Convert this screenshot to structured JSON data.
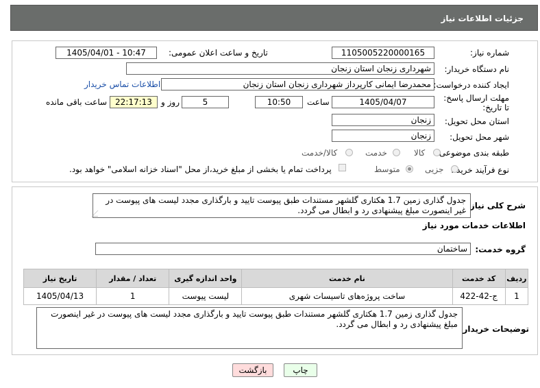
{
  "header": {
    "title": "جزئیات اطلاعات نیاز"
  },
  "form": {
    "need_number_label": "شماره نیاز:",
    "need_number": "1105005220000165",
    "announce_label": "تاریخ و ساعت اعلان عمومی:",
    "announce_value": "1405/04/01 - 10:47",
    "buyer_org_label": "نام دستگاه خریدار:",
    "buyer_org": "شهرداری زنجان استان زنجان",
    "creator_label": "ایجاد کننده درخواست:",
    "creator": "محمدرضا  ایمانی کارپرداز شهرداری زنجان استان زنجان",
    "contact_link": "اطلاعات تماس خریدار",
    "deadline_label": "مهلت ارسال پاسخ: تا تاریخ:",
    "deadline_date": "1405/04/07",
    "time_label": "ساعت",
    "deadline_time": "10:50",
    "days_value": "5",
    "days_label": "روز و",
    "remaining_time": "22:17:13",
    "remaining_label": "ساعت باقی مانده",
    "province_label": "استان محل تحویل:",
    "province": "زنجان",
    "city_label": "شهر محل تحویل:",
    "city": "زنجان",
    "category_label": "طبقه بندی موضوعی:",
    "category_options": [
      "کالا",
      "خدمت",
      "کالا/خدمت"
    ],
    "process_label": "نوع فرآیند خرید :",
    "process_options": [
      "جزیی",
      "متوسط"
    ],
    "payment_note": "پرداخت تمام یا بخشی از مبلغ خرید،از محل \"اسناد خزانه اسلامی\" خواهد بود."
  },
  "description": {
    "label": "شرح کلی نیاز:",
    "text": "جدول گذاری زمین 1.7 هکتاری گلشهر مستندات طبق پیوست تایید و بارگذاری مجدد لیست های پیوست در غیر اینصورت مبلغ پیشنهادی رد و ابطال می گردد."
  },
  "services": {
    "section_title": "اطلاعات خدمات مورد نیاز",
    "group_label": "گروه خدمت:",
    "group_value": "ساختمان",
    "columns": [
      "ردیف",
      "کد خدمت",
      "نام خدمت",
      "واحد اندازه گیری",
      "تعداد / مقدار",
      "تاریخ نیاز"
    ],
    "rows": [
      {
        "index": "1",
        "code": "ج-42-422",
        "name": "ساخت پروژه‌های تاسیسات شهری",
        "unit": "لیست پیوست",
        "qty": "1",
        "date": "1405/04/13"
      }
    ]
  },
  "buyer_notes": {
    "label": "توضیحات خریدار:",
    "text": "جدول گذاری زمین 1.7 هکتاری گلشهر مستندات طبق پیوست تایید و بارگذاری مجدد لیست های پیوست در غیر اینصورت مبلغ پیشنهادی رد و ابطال می گردد."
  },
  "buttons": {
    "print": "چاپ",
    "back": "بازگشت"
  },
  "colors": {
    "header_bg": "#6a6d6b",
    "back_button_bg": "#ffdcdc",
    "print_button_bg": "#e9ffe9"
  }
}
